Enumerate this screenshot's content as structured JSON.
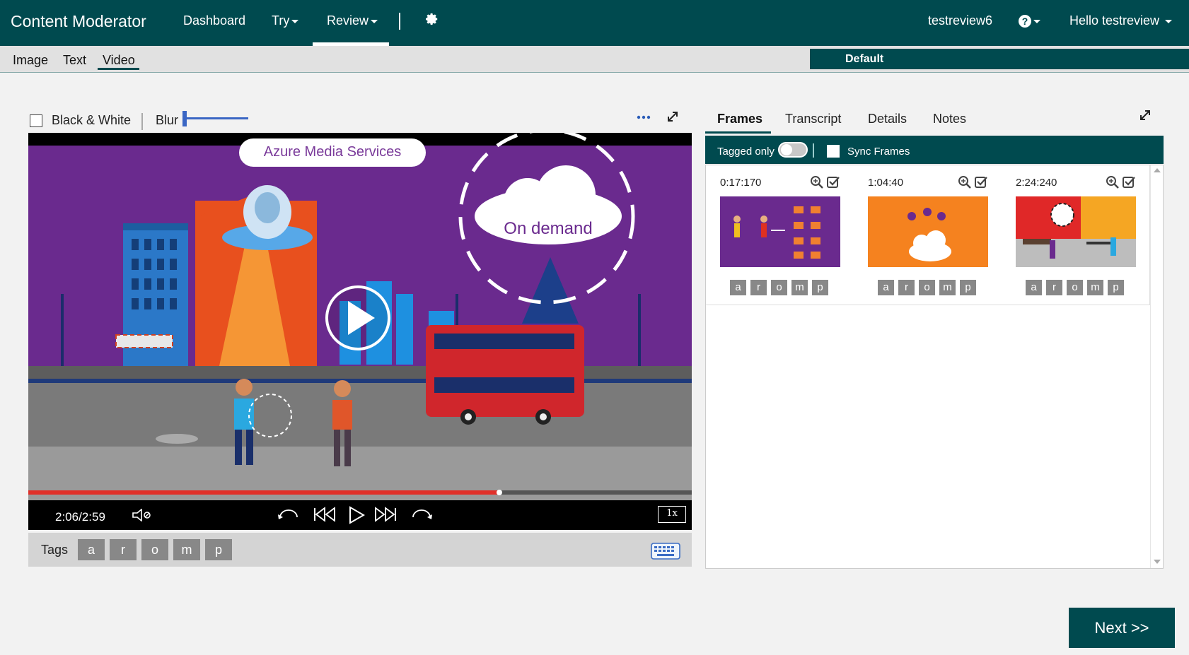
{
  "app": {
    "title": "Content Moderator"
  },
  "topnav": {
    "dashboard": "Dashboard",
    "try": "Try",
    "review": "Review",
    "team": "testreview6",
    "user": "Hello testreview"
  },
  "subnav": {
    "image": "Image",
    "text": "Text",
    "video": "Video",
    "team_name": "Default"
  },
  "toolbar": {
    "bw_label": "Black & White",
    "blur_label": "Blur",
    "blur_value": 0
  },
  "video": {
    "banner": "Azure Media Services",
    "cloud_text": "On demand",
    "time": "2:06/2:59",
    "speed": "1x",
    "progress": 0.71
  },
  "tags": {
    "label": "Tags",
    "items": [
      "a",
      "r",
      "o",
      "m",
      "p"
    ]
  },
  "panel": {
    "tabs": [
      "Frames",
      "Transcript",
      "Details",
      "Notes"
    ],
    "tagged_only": "Tagged only",
    "sync_frames": "Sync Frames",
    "frames": [
      {
        "time": "0:17:170",
        "tags": [
          "a",
          "r",
          "o",
          "m",
          "p"
        ]
      },
      {
        "time": "1:04:40",
        "tags": [
          "a",
          "r",
          "o",
          "m",
          "p"
        ]
      },
      {
        "time": "2:24:240",
        "tags": [
          "a",
          "r",
          "o",
          "m",
          "p"
        ]
      }
    ]
  },
  "actions": {
    "next": "Next >>"
  },
  "colors": {
    "brand": "#004a4f",
    "accent": "#3a66c4",
    "progress": "#e0302a"
  }
}
